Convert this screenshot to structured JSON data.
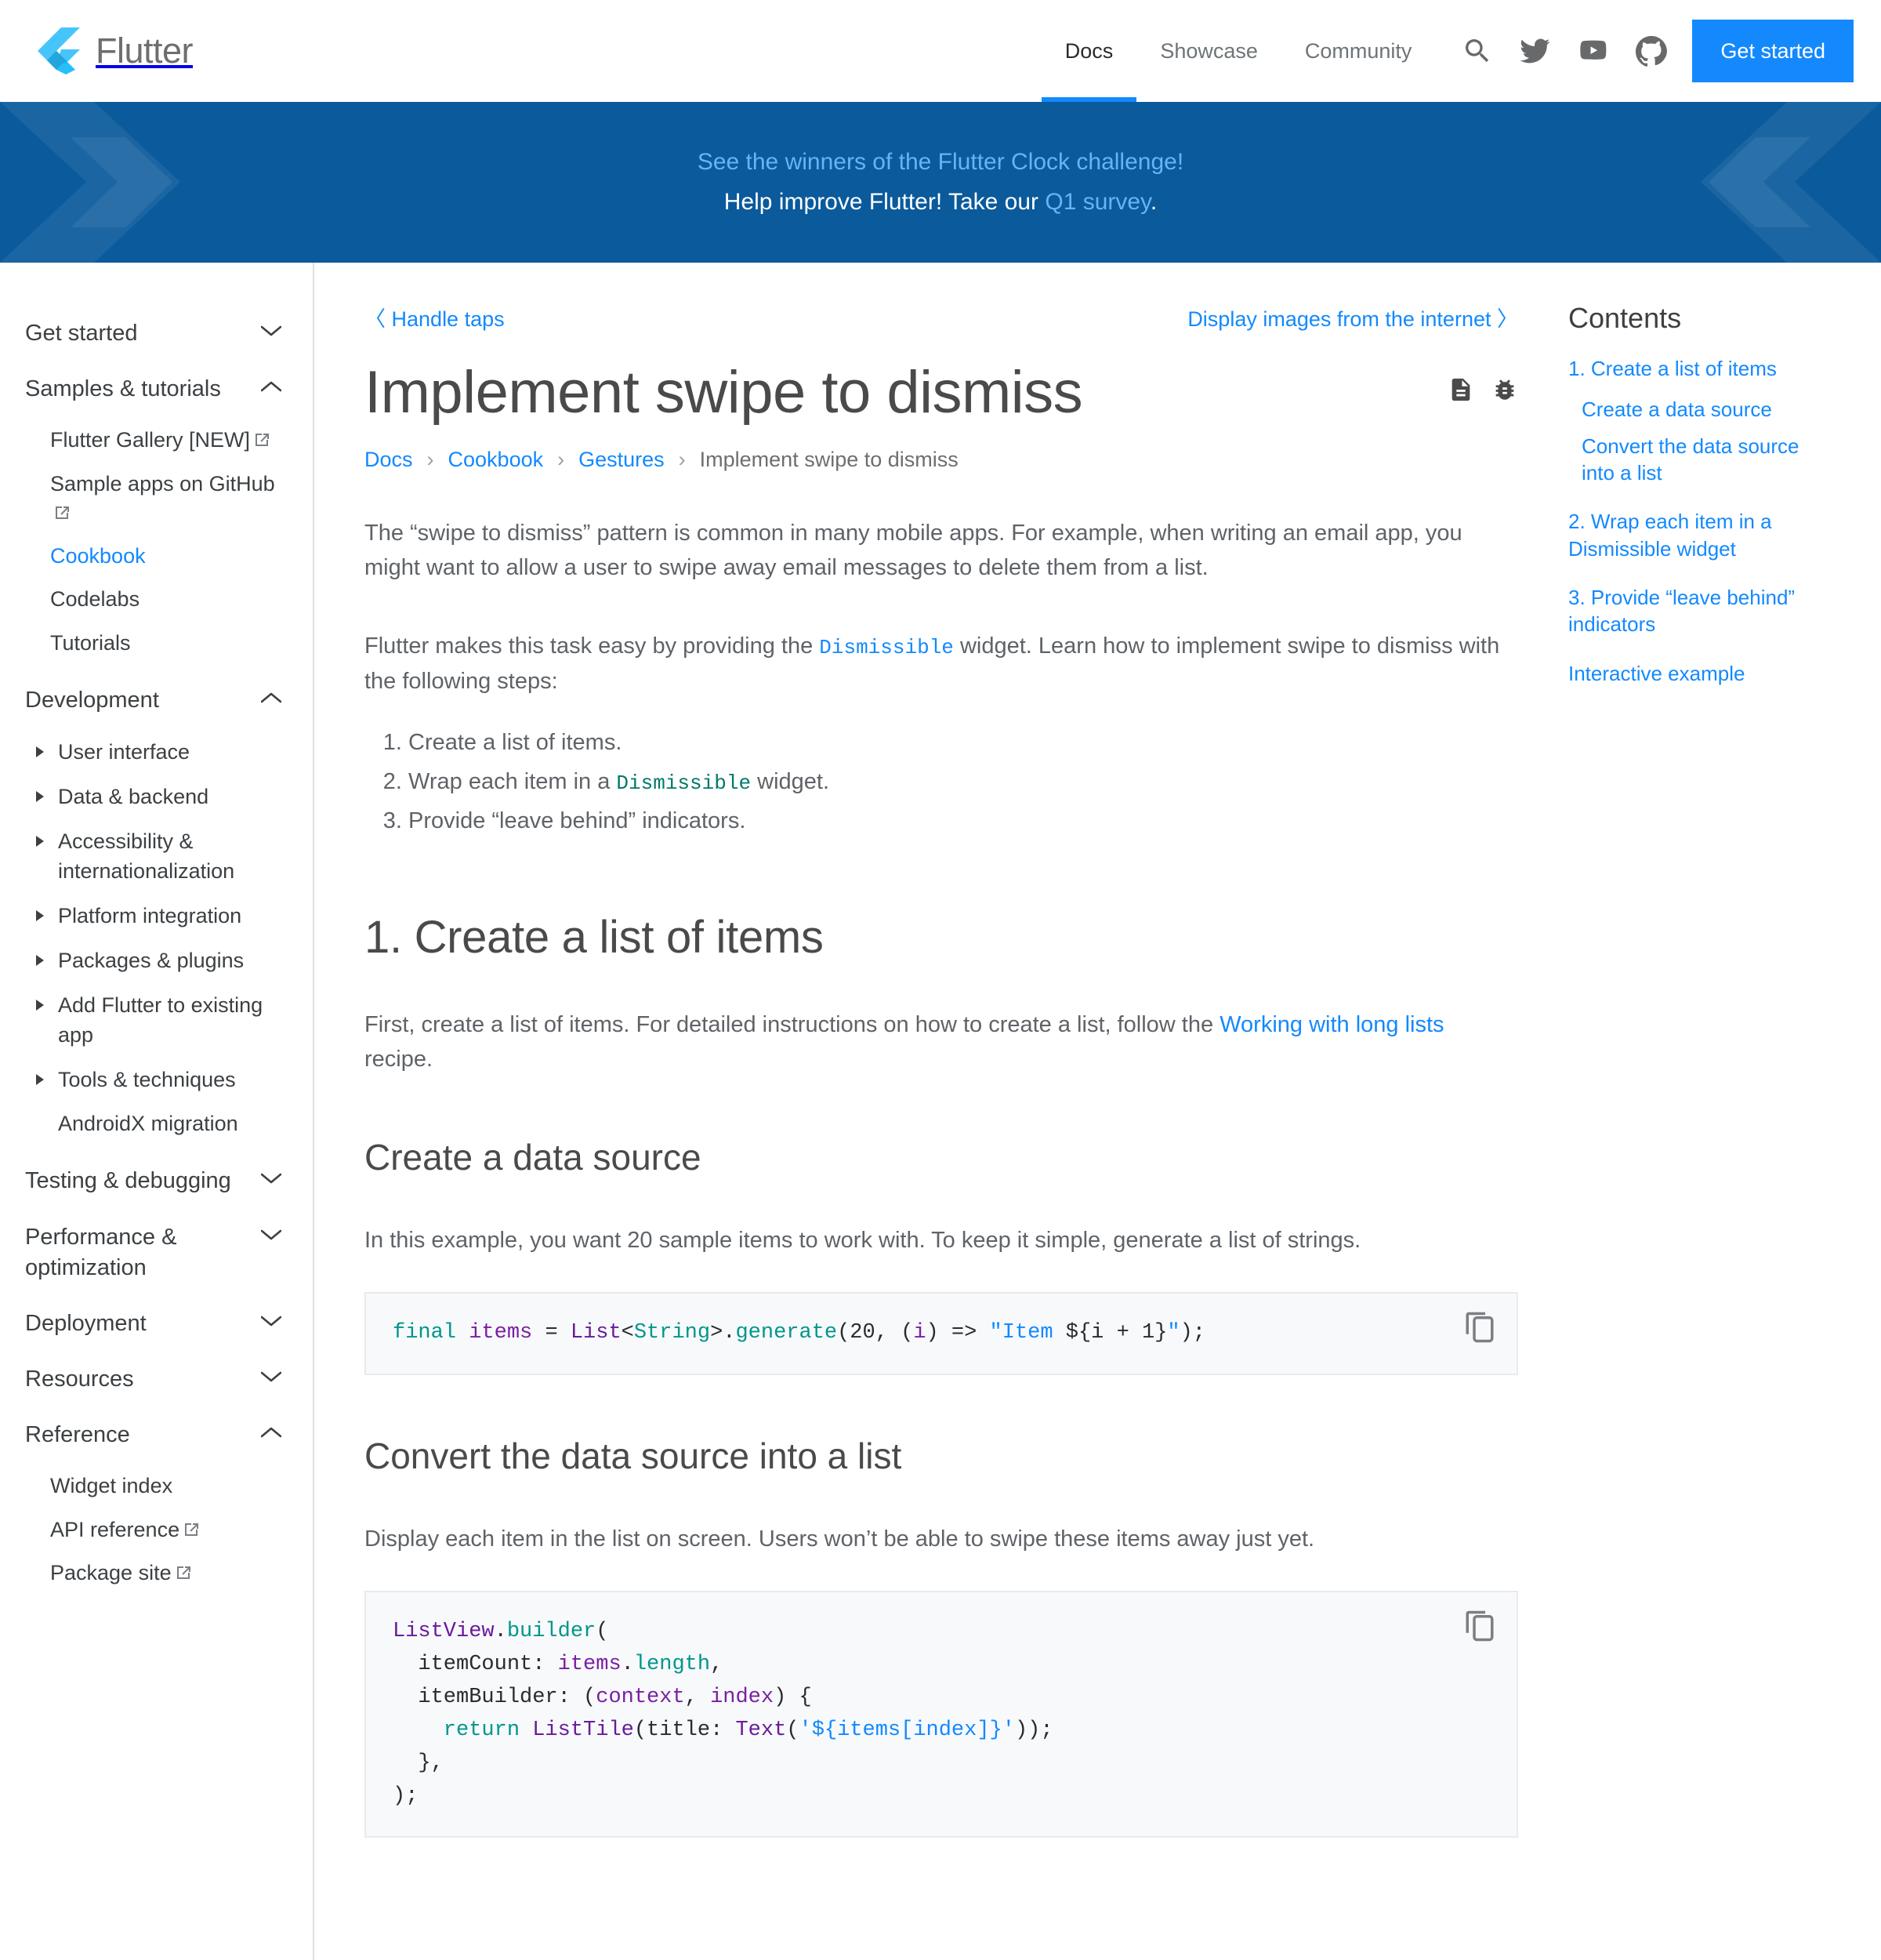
{
  "brand": {
    "name": "Flutter"
  },
  "topnav": {
    "links": [
      {
        "label": "Docs",
        "active": true
      },
      {
        "label": "Showcase",
        "active": false
      },
      {
        "label": "Community",
        "active": false
      }
    ],
    "icons": [
      "search-icon",
      "twitter-icon",
      "youtube-icon",
      "github-icon"
    ],
    "cta_label": "Get started",
    "accent_color": "#1389fd"
  },
  "banner": {
    "background_color": "#0a5a9c",
    "link_color": "#64b5f6",
    "line1_link": "See the winners of the Flutter Clock challenge!",
    "line2_prefix": "Help improve Flutter! Take our ",
    "line2_link": "Q1 survey",
    "line2_suffix": "."
  },
  "sidebar": {
    "groups": [
      {
        "label": "Get started",
        "state": "collapsed",
        "chevron": "chevron-down-icon",
        "children": []
      },
      {
        "label": "Samples & tutorials",
        "state": "expanded",
        "chevron": "chevron-up-icon",
        "children": [
          {
            "label": "Flutter Gallery [NEW]",
            "external": true,
            "current": false
          },
          {
            "label": "Sample apps on GitHub",
            "external": true,
            "current": false
          },
          {
            "label": "Cookbook",
            "external": false,
            "current": true
          },
          {
            "label": "Codelabs",
            "external": false,
            "current": false
          },
          {
            "label": "Tutorials",
            "external": false,
            "current": false
          }
        ]
      },
      {
        "label": "Development",
        "state": "expanded",
        "chevron": "chevron-up-icon",
        "expandables": [
          "User interface",
          "Data & backend",
          "Accessibility & internationalization",
          "Platform integration",
          "Packages & plugins",
          "Add Flutter to existing app",
          "Tools & techniques"
        ],
        "children": [
          {
            "label": "AndroidX migration",
            "external": false,
            "current": false
          }
        ]
      },
      {
        "label": "Testing & debugging",
        "state": "collapsed",
        "chevron": "chevron-down-icon",
        "children": []
      },
      {
        "label": "Performance & optimization",
        "state": "collapsed",
        "chevron": "chevron-down-icon",
        "children": []
      },
      {
        "label": "Deployment",
        "state": "collapsed",
        "chevron": "chevron-down-icon",
        "children": []
      },
      {
        "label": "Resources",
        "state": "collapsed",
        "chevron": "chevron-down-icon",
        "children": []
      },
      {
        "label": "Reference",
        "state": "expanded",
        "chevron": "chevron-up-icon",
        "children": [
          {
            "label": "Widget index",
            "external": false,
            "current": false
          },
          {
            "label": "API reference",
            "external": true,
            "current": false
          },
          {
            "label": "Package site",
            "external": true,
            "current": false
          }
        ]
      }
    ]
  },
  "pager": {
    "prev_label": "Handle taps",
    "prev_arrow": "〈",
    "next_label": "Display images from the internet",
    "next_arrow": "〉"
  },
  "page": {
    "title": "Implement swipe to dismiss",
    "title_icons": [
      "page-source-icon",
      "bug-report-icon"
    ],
    "breadcrumb": [
      {
        "label": "Docs",
        "link": true
      },
      {
        "label": "Cookbook",
        "link": true
      },
      {
        "label": "Gestures",
        "link": true
      },
      {
        "label": "Implement swipe to dismiss",
        "link": false
      }
    ],
    "breadcrumb_sep": "›"
  },
  "content": {
    "intro_p1_a": "The “swipe to dismiss” pattern is common in many mobile apps. For example, when writing an email app, you might want to allow a user to swipe away email messages to delete them from a list.",
    "intro_p2_a": "Flutter makes this task easy by providing the ",
    "intro_p2_code": "Dismissible",
    "intro_p2_b": " widget. Learn how to implement swipe to dismiss with the following steps:",
    "steps": [
      {
        "text_a": "Create a list of items.",
        "code": "",
        "text_b": ""
      },
      {
        "text_a": "Wrap each item in a ",
        "code": "Dismissible",
        "text_b": " widget."
      },
      {
        "text_a": "Provide “leave behind” indicators.",
        "code": "",
        "text_b": ""
      }
    ],
    "h2_create_list": "1. Create a list of items",
    "p_create_list_a": "First, create a list of items. For detailed instructions on how to create a list, follow the ",
    "p_create_list_link": "Working with long lists",
    "p_create_list_b": " recipe.",
    "h3_data_source": "Create a data source",
    "p_data_source": "In this example, you want 20 sample items to work with. To keep it simple, generate a list of strings.",
    "h3_convert": "Convert the data source into a list",
    "p_convert": "Display each item in the list on screen. Users won’t be able to swipe these items away just yet.",
    "copy_icon": "copy-icon"
  },
  "code1": {
    "t1": "final ",
    "t2": "items ",
    "t3": "= ",
    "t4": "List",
    "t5": "<",
    "t6": "String",
    "t7": ">",
    "t8": ".",
    "t9": "generate",
    "t10": "(20, (",
    "t11": "i",
    "t12": ") => ",
    "t13": "\"Item ",
    "t14": "${i + 1}",
    "t15": "\"",
    "t16": ");"
  },
  "code2": {
    "l1a": "ListView",
    "l1b": ".",
    "l1c": "builder",
    "l1d": "(",
    "l2a": "  itemCount: ",
    "l2b": "items",
    "l2c": ".",
    "l2d": "length",
    "l2e": ",",
    "l3a": "  itemBuilder: (",
    "l3b": "context",
    "l3c": ", ",
    "l3d": "index",
    "l3e": ") {",
    "l4a": "    return ",
    "l4b": "ListTile",
    "l4c": "(title: ",
    "l4d": "Text",
    "l4e": "(",
    "l4f": "'${items[index]}'",
    "l4g": "));",
    "l5": "  },",
    "l6": ");"
  },
  "toc": {
    "title": "Contents",
    "items": [
      {
        "label": "1. Create a list of items",
        "level": 1,
        "gap": false
      },
      {
        "label": "Create a data source",
        "level": 2,
        "gap": false
      },
      {
        "label": "Convert the data source into a list",
        "level": 2,
        "gap": false
      },
      {
        "label": "2. Wrap each item in a Dismissible widget",
        "level": 1,
        "gap": true
      },
      {
        "label": "3. Provide “leave behind” indicators",
        "level": 1,
        "gap": true
      },
      {
        "label": "Interactive example",
        "level": 1,
        "gap": true
      }
    ]
  }
}
